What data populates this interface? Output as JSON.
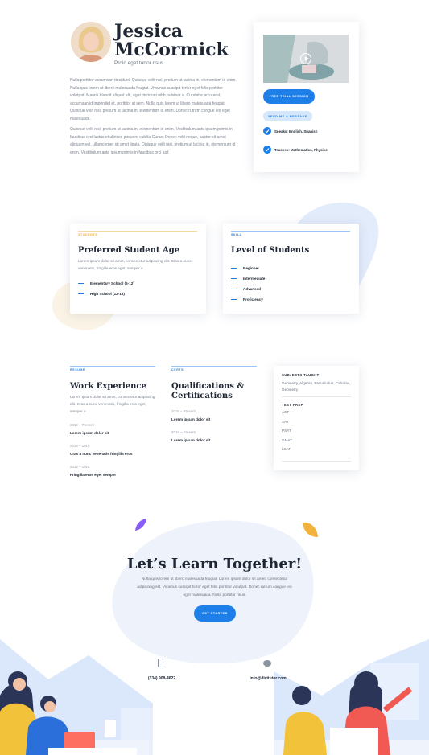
{
  "profile": {
    "first_name": "Jessica",
    "last_name": "McCormick",
    "subtitle": "Proin eget tortor risus",
    "bio_1": "Nulla porttitor accumsan tincidunt. Quisque velit nisi, pretium ut lacinia in, elementum id enim. Nulla quis lorem ut libero malesuada feugiat. Vivamus suscipit tortor eget felis porttitor volutpat. Mauris blandit aliquet elit, eget tincidunt nibh pulvinar a. Curabitur arcu erat, accumsan id imperdiet et, porttitor at sem. Nulla quis lorem ut libero malesuada feugiat. Quisque velit nisi, pretium ut lacinia in, elementum id enim. Donec rutrum congue leo eget malesuada.",
    "bio_2": "Quisque velit nisi, pretium ut lacinia in, elementum id enim. Vestibulum ante ipsum primis in faucibus orci luctus et ultrices posuere cubilia Curae; Donec velit neque, auctor sit amet aliquam vel, ullamcorper sit amet ligula. Quisque velit nisi, pretium ut lacinia in, elementum id enim. Vestibulum ante ipsum primis in faucibus orci luct"
  },
  "side_card": {
    "trial_button": "FREE TRIAL SESSION",
    "message_button": "SEND ME A MESSAGE",
    "speaks": "Speaks: English, Spanish",
    "teaches": "Teaches: Mathematics, Physics"
  },
  "age_card": {
    "tag": "STUDENTS",
    "title": "Preferred Student Age",
    "text": "Lorem ipsum dolor sit amet, consectetur adipiscing elit. Cras a nunc venenatis, fringilla eros eget, semper o",
    "items": [
      "Elementary School (6-12)",
      "High School (12-18)"
    ]
  },
  "level_card": {
    "tag": "SKILL",
    "title": "Level of Students",
    "items": [
      "Beginner",
      "Intermediate",
      "Advanced",
      "Proficiency"
    ]
  },
  "resume": {
    "tag": "RESUME",
    "title": "Work Experience",
    "text": "Lorem ipsum dolor sit amet, consectetur adipiscing elit. Cras a nunc venenatis, fringilla eros eget, semper o",
    "entries": [
      {
        "date": "2019 – Present",
        "desc": "Lorem ipsum dolor sit"
      },
      {
        "date": "2015 – 2019",
        "desc": "Cras a nunc venenatis fringilla eros"
      },
      {
        "date": "2012 – 2015",
        "desc": "Fringilla eros eget semper"
      }
    ]
  },
  "certs": {
    "tag": "CERTS",
    "title_1": "Qualifications &",
    "title_2": "Certifications",
    "entries": [
      {
        "date": "2019 – Present",
        "desc": "Lorem ipsum dolor sit"
      },
      {
        "date": "2019 – Present",
        "desc": "Lorem ipsum dolor sit"
      }
    ]
  },
  "subjects": {
    "heading": "SUBJECTS TAUGHT",
    "list": "Geometry, Algebra, Precalculus, Calculus, Geometry",
    "test_heading": "TEST PREP",
    "tests": [
      "ACT",
      "SAT",
      "PSAT",
      "GMAT",
      "LSAT"
    ]
  },
  "cta": {
    "title": "Let’s Learn Together!",
    "text": "Nulla quis lorem ut libero malesuada feugiat. Lorem ipsum dolor sit amet, consectetur adipiscing elit. Vivamus suscipit tortor eget felis porttitor volutpat. Donec rutrum congue leo eget malesuada. Nulla porttitor risus.",
    "button": "GET STARTED",
    "phone": "(134) 908-4622",
    "email": "info@divitutor.com"
  },
  "colors": {
    "accent": "#1f7fe8",
    "gold": "#f2b33d",
    "purple": "#8a5cf6",
    "blob": "#eef3fc"
  },
  "icons": [
    "play-icon",
    "check-icon",
    "phone-icon",
    "chat-icon"
  ]
}
